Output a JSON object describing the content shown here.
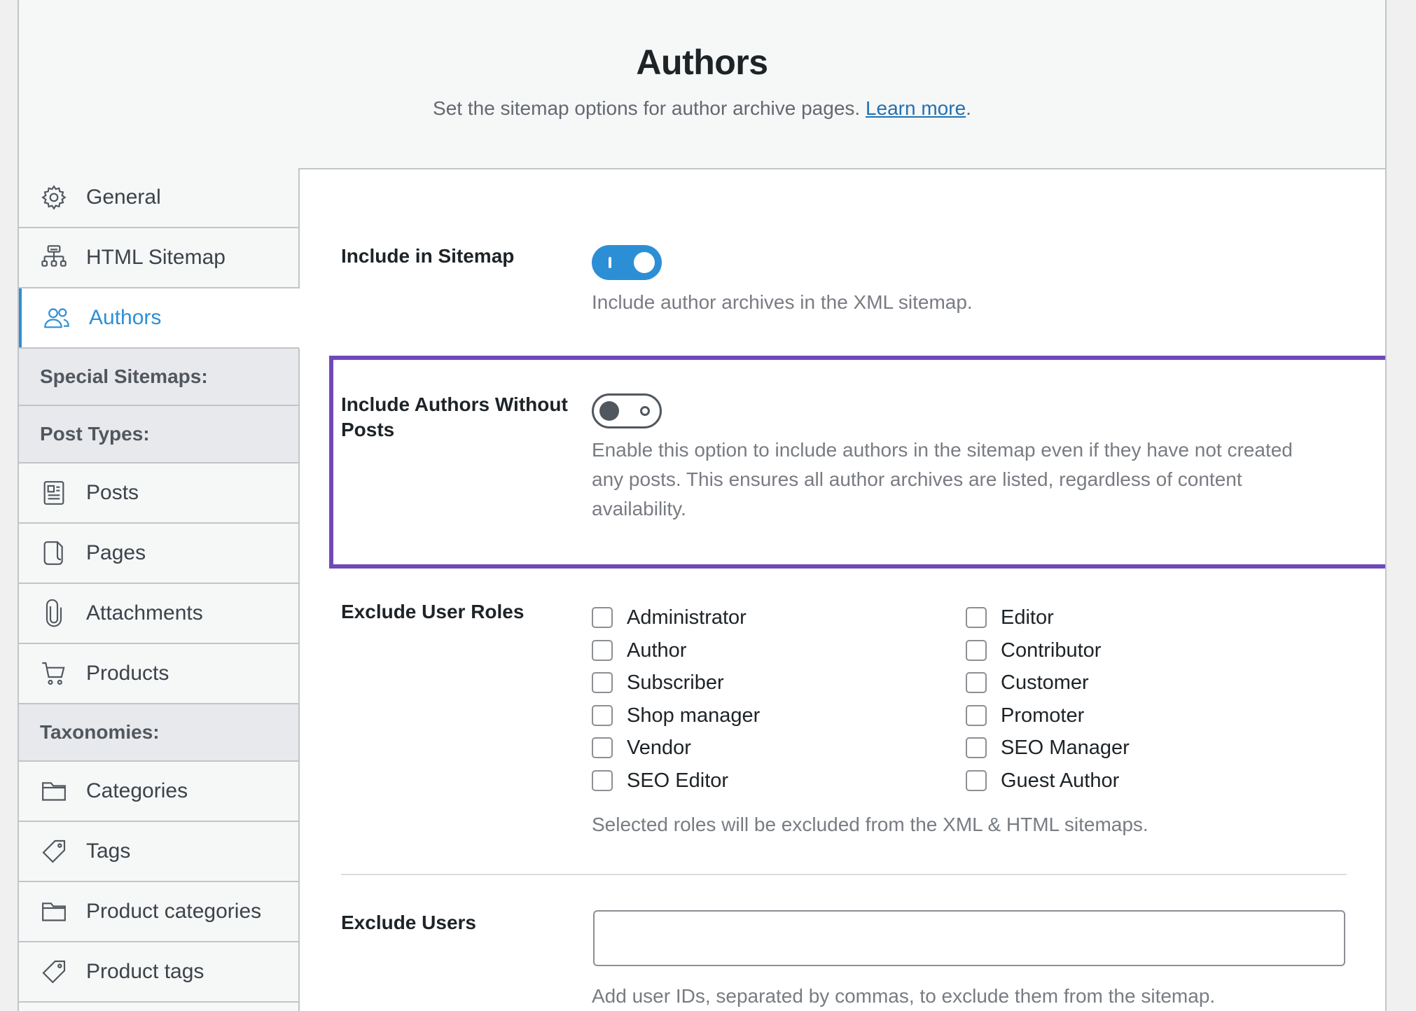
{
  "header": {
    "title": "Authors",
    "description": "Set the sitemap options for author archive pages.",
    "learn_more": "Learn more",
    "period": "."
  },
  "sidebar": {
    "items": [
      {
        "label": "General",
        "icon": "gear-icon"
      },
      {
        "label": "HTML Sitemap",
        "icon": "sitemap-icon"
      },
      {
        "label": "Authors",
        "icon": "users-icon",
        "active": true
      }
    ],
    "section_special": "Special Sitemaps:",
    "section_post_types": "Post Types:",
    "post_types": [
      {
        "label": "Posts",
        "icon": "posts-icon"
      },
      {
        "label": "Pages",
        "icon": "pages-icon"
      },
      {
        "label": "Attachments",
        "icon": "paperclip-icon"
      },
      {
        "label": "Products",
        "icon": "cart-icon"
      }
    ],
    "section_taxonomies": "Taxonomies:",
    "taxonomies": [
      {
        "label": "Categories",
        "icon": "folder-icon"
      },
      {
        "label": "Tags",
        "icon": "tag-icon"
      },
      {
        "label": "Product categories",
        "icon": "folder-icon"
      },
      {
        "label": "Product tags",
        "icon": "tag-icon"
      }
    ]
  },
  "settings": {
    "include_in_sitemap": {
      "label": "Include in Sitemap",
      "enabled": true,
      "help": "Include author archives in the XML sitemap."
    },
    "include_without_posts": {
      "label_line1": "Include Authors Without",
      "label_line2": "Posts",
      "enabled": false,
      "help_line1": "Enable this option to include authors in the sitemap even if they have not created",
      "help_line2": "any posts. This ensures all author archives are listed, regardless of content",
      "help_line3": "availability."
    },
    "exclude_user_roles": {
      "label": "Exclude User Roles",
      "roles_left": [
        "Administrator",
        "Author",
        "Subscriber",
        "Shop manager",
        "Vendor",
        "SEO Editor"
      ],
      "roles_right": [
        "Editor",
        "Contributor",
        "Customer",
        "Promoter",
        "SEO Manager",
        "Guest Author"
      ],
      "help": "Selected roles will be excluded from the XML & HTML sitemaps."
    },
    "exclude_users": {
      "label": "Exclude Users",
      "value": "",
      "help": "Add user IDs, separated by commas, to exclude them from the sitemap."
    }
  },
  "colors": {
    "accent": "#2c8fd6",
    "highlight_border": "#7049b8"
  }
}
